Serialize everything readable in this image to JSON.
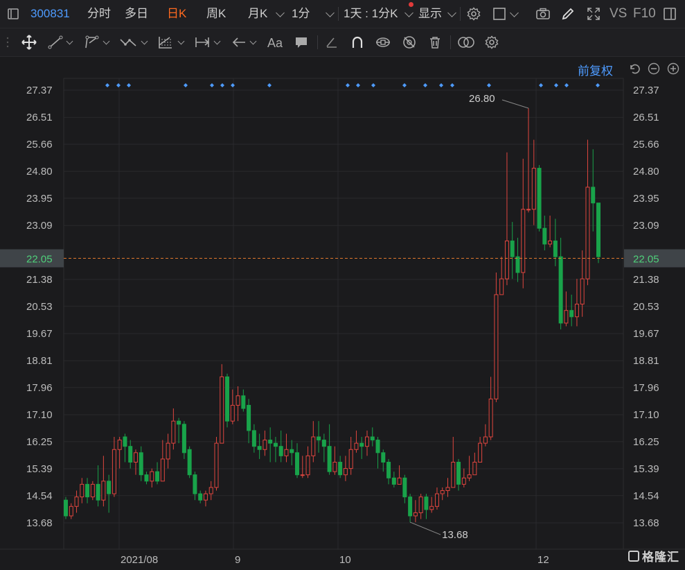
{
  "toolbar": {
    "stock_code": "300831",
    "fenshi": "分时",
    "duori": "多日",
    "rik": "日K",
    "zhouk": "周K",
    "yuek": "月K",
    "one_min": "1分",
    "one_day_1mk": "1天 : 1分K",
    "xianshi": "显示",
    "vs": "VS",
    "f10": "F10"
  },
  "adjust_label": "前复权",
  "watermark": "格隆汇",
  "colors": {
    "up": "#e0463f",
    "down": "#19a34a",
    "accent": "#4e9bff",
    "active_tab": "#ff6a1f",
    "price_line": "#e0782f"
  },
  "icons": {
    "row1": [
      "settings-gear-icon",
      "square-icon",
      "camera-icon",
      "pencil-icon",
      "fullscreen-icon",
      "panel-icon"
    ],
    "row2": [
      "move-cross-icon",
      "line-tool-icon",
      "polyline-tool-icon",
      "wave-tool-icon",
      "fib-tool-icon",
      "measure-tool-icon",
      "arrow-tool-icon",
      "text-tool-icon",
      "comment-tool-icon",
      "eraser-tool-icon",
      "magnet-icon",
      "link-icon",
      "eye-hide-icon",
      "trash-icon",
      "overlay-icon",
      "settings-gear-icon"
    ]
  },
  "chart_data": {
    "type": "candlestick",
    "y_ticks": [
      "27.37",
      "26.51",
      "25.66",
      "24.80",
      "23.95",
      "23.09",
      "22.05",
      "21.38",
      "20.53",
      "19.67",
      "18.81",
      "17.96",
      "17.10",
      "16.25",
      "15.39",
      "14.54",
      "13.68"
    ],
    "ylim": [
      13.68,
      27.37
    ],
    "x_labels": [
      "2021/08",
      "9",
      "10",
      "12"
    ],
    "current_price": 22.05,
    "high_label": "26.80",
    "low_label": "13.68",
    "candles": [
      [
        14.4,
        13.9,
        14.5,
        13.8
      ],
      [
        13.9,
        14.2,
        14.3,
        13.8
      ],
      [
        14.2,
        14.5,
        14.7,
        14.0
      ],
      [
        14.5,
        14.9,
        15.1,
        14.3
      ],
      [
        14.9,
        14.5,
        15.1,
        14.3
      ],
      [
        14.5,
        14.9,
        15.0,
        14.4
      ],
      [
        14.9,
        14.4,
        15.5,
        14.2
      ],
      [
        14.4,
        15.0,
        15.8,
        14.2
      ],
      [
        15.0,
        14.6,
        15.2,
        14.0
      ],
      [
        14.6,
        16.0,
        16.4,
        14.5
      ],
      [
        16.0,
        16.3,
        16.4,
        15.4
      ],
      [
        16.4,
        16.1,
        16.5,
        15.6
      ],
      [
        16.1,
        15.6,
        16.3,
        15.4
      ],
      [
        15.6,
        15.9,
        16.0,
        15.2
      ],
      [
        15.9,
        15.2,
        16.1,
        15.0
      ],
      [
        15.2,
        15.0,
        15.3,
        14.9
      ],
      [
        15.0,
        15.3,
        15.4,
        14.8
      ],
      [
        15.3,
        15.0,
        15.6,
        14.9
      ],
      [
        15.0,
        15.7,
        16.3,
        15.0
      ],
      [
        15.7,
        16.2,
        16.5,
        15.4
      ],
      [
        16.2,
        16.9,
        17.3,
        16.0
      ],
      [
        16.9,
        16.8,
        17.0,
        16.2
      ],
      [
        16.8,
        15.9,
        16.9,
        15.7
      ],
      [
        16.0,
        15.2,
        16.1,
        15.1
      ],
      [
        15.2,
        14.6,
        15.3,
        14.4
      ],
      [
        14.6,
        14.4,
        14.7,
        14.3
      ],
      [
        14.4,
        14.6,
        14.7,
        14.2
      ],
      [
        14.6,
        14.8,
        15.0,
        14.4
      ],
      [
        14.8,
        16.2,
        16.4,
        14.7
      ],
      [
        16.2,
        18.3,
        18.7,
        16.2
      ],
      [
        18.3,
        16.9,
        18.4,
        16.7
      ],
      [
        16.9,
        17.4,
        17.9,
        16.8
      ],
      [
        17.4,
        17.7,
        18.0,
        16.9
      ],
      [
        17.7,
        17.3,
        17.9,
        17.2
      ],
      [
        17.4,
        16.6,
        17.6,
        16.2
      ],
      [
        16.6,
        16.1,
        16.8,
        15.9
      ],
      [
        16.1,
        16.0,
        16.5,
        15.7
      ],
      [
        16.0,
        16.3,
        16.6,
        15.8
      ],
      [
        16.3,
        16.2,
        16.7,
        15.6
      ],
      [
        16.2,
        16.1,
        16.4,
        15.6
      ],
      [
        16.1,
        15.8,
        16.6,
        15.6
      ],
      [
        15.8,
        16.0,
        16.5,
        15.6
      ],
      [
        16.0,
        15.9,
        16.3,
        15.5
      ],
      [
        15.9,
        15.2,
        16.2,
        15.1
      ],
      [
        15.2,
        15.2,
        15.8,
        15.1
      ],
      [
        15.2,
        15.8,
        16.1,
        15.1
      ],
      [
        15.8,
        16.4,
        16.9,
        15.6
      ],
      [
        16.4,
        16.3,
        16.9,
        15.9
      ],
      [
        16.3,
        16.1,
        16.5,
        15.6
      ],
      [
        16.1,
        15.3,
        16.8,
        15.2
      ],
      [
        15.3,
        15.6,
        16.1,
        15.2
      ],
      [
        15.6,
        15.2,
        15.8,
        15.1
      ],
      [
        15.2,
        15.4,
        15.8,
        15.0
      ],
      [
        15.4,
        16.0,
        16.4,
        15.2
      ],
      [
        16.0,
        16.2,
        16.6,
        15.9
      ],
      [
        16.2,
        16.1,
        16.4,
        15.7
      ],
      [
        16.1,
        16.4,
        16.6,
        15.8
      ],
      [
        16.4,
        16.3,
        16.7,
        16.1
      ],
      [
        16.3,
        15.9,
        16.4,
        15.4
      ],
      [
        15.9,
        15.6,
        16.0,
        15.3
      ],
      [
        15.6,
        15.1,
        15.7,
        14.9
      ],
      [
        15.1,
        14.9,
        15.3,
        14.8
      ],
      [
        14.9,
        15.1,
        15.5,
        14.9
      ],
      [
        15.1,
        14.5,
        15.2,
        14.3
      ],
      [
        14.5,
        13.9,
        14.6,
        13.7
      ],
      [
        13.9,
        14.0,
        14.4,
        13.7
      ],
      [
        14.0,
        14.5,
        14.6,
        13.8
      ],
      [
        14.5,
        14.1,
        14.6,
        13.8
      ],
      [
        14.1,
        14.2,
        14.5,
        14.0
      ],
      [
        14.2,
        14.6,
        14.8,
        14.1
      ],
      [
        14.6,
        14.7,
        14.8,
        14.4
      ],
      [
        14.7,
        14.8,
        15.1,
        14.5
      ],
      [
        14.8,
        15.6,
        16.4,
        14.8
      ],
      [
        15.6,
        14.9,
        15.7,
        14.7
      ],
      [
        14.9,
        15.1,
        15.4,
        14.8
      ],
      [
        15.1,
        15.2,
        15.8,
        15.0
      ],
      [
        15.2,
        15.6,
        15.9,
        15.2
      ],
      [
        15.6,
        16.2,
        16.4,
        15.6
      ],
      [
        16.2,
        16.4,
        16.8,
        16.1
      ],
      [
        16.4,
        17.6,
        18.3,
        16.3
      ],
      [
        17.6,
        20.9,
        21.6,
        17.5
      ],
      [
        20.9,
        21.4,
        22.1,
        20.9
      ],
      [
        21.4,
        22.6,
        25.4,
        21.2
      ],
      [
        22.6,
        22.1,
        23.2,
        21.4
      ],
      [
        22.1,
        21.6,
        22.7,
        21.3
      ],
      [
        21.6,
        23.6,
        25.2,
        21.1
      ],
      [
        23.6,
        23.6,
        26.8,
        23.5
      ],
      [
        23.6,
        24.9,
        25.8,
        23.1
      ],
      [
        24.9,
        23.0,
        25.0,
        22.9
      ],
      [
        23.0,
        22.5,
        23.4,
        22.3
      ],
      [
        22.5,
        22.6,
        23.4,
        22.4
      ],
      [
        22.6,
        22.1,
        23.3,
        21.8
      ],
      [
        22.1,
        20.0,
        22.7,
        19.8
      ],
      [
        20.0,
        20.4,
        21.0,
        19.9
      ],
      [
        20.4,
        20.2,
        20.9,
        19.9
      ],
      [
        20.2,
        20.6,
        21.4,
        19.9
      ],
      [
        20.6,
        21.4,
        22.3,
        20.2
      ],
      [
        21.4,
        24.3,
        25.8,
        21.2
      ],
      [
        24.3,
        23.8,
        25.5,
        22.9
      ],
      [
        23.8,
        22.1,
        23.2,
        21.9
      ]
    ],
    "markers": [
      155,
      171,
      186,
      268,
      306,
      321,
      336,
      389,
      502,
      517,
      539,
      584,
      614,
      637,
      653,
      706,
      781,
      803,
      818,
      863
    ]
  }
}
